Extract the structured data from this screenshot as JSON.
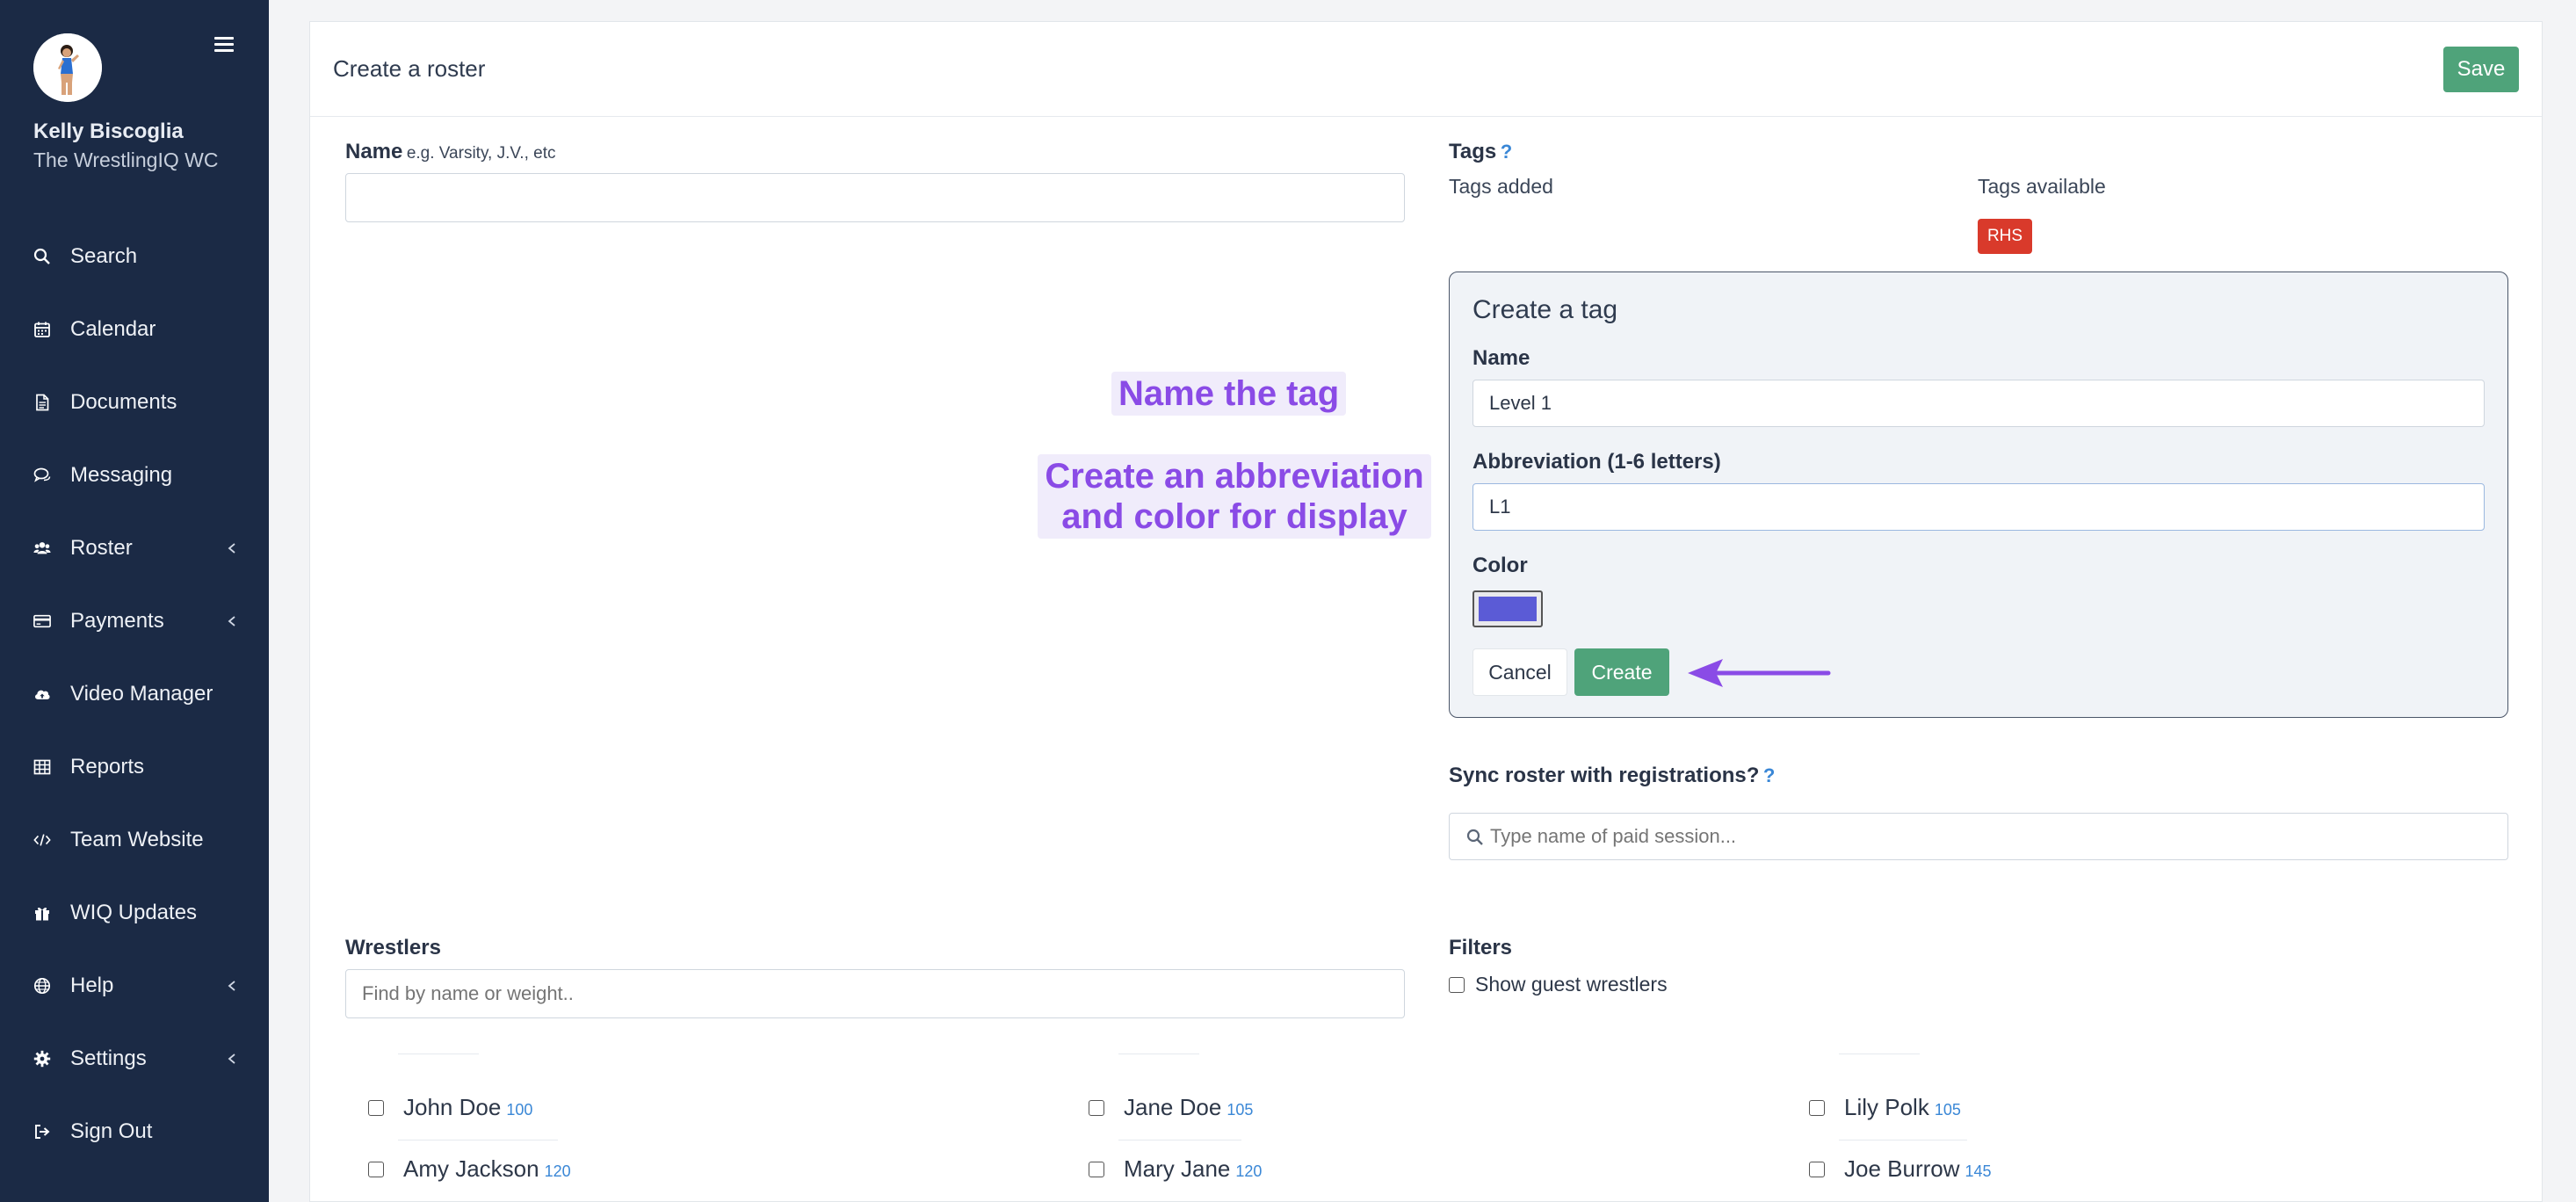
{
  "sidebar": {
    "user_name": "Kelly Biscoglia",
    "user_org": "The WrestlingIQ WC",
    "items": [
      {
        "label": "Search",
        "icon": "search-icon",
        "has_chevron": false
      },
      {
        "label": "Calendar",
        "icon": "calendar-icon",
        "has_chevron": false
      },
      {
        "label": "Documents",
        "icon": "document-icon",
        "has_chevron": false
      },
      {
        "label": "Messaging",
        "icon": "chat-icon",
        "has_chevron": false
      },
      {
        "label": "Roster",
        "icon": "users-icon",
        "has_chevron": true
      },
      {
        "label": "Payments",
        "icon": "credit-card-icon",
        "has_chevron": true
      },
      {
        "label": "Video Manager",
        "icon": "cloud-upload-icon",
        "has_chevron": false
      },
      {
        "label": "Reports",
        "icon": "table-icon",
        "has_chevron": false
      },
      {
        "label": "Team Website",
        "icon": "code-icon",
        "has_chevron": false
      },
      {
        "label": "WIQ Updates",
        "icon": "gift-icon",
        "has_chevron": false
      },
      {
        "label": "Help",
        "icon": "globe-icon",
        "has_chevron": true
      },
      {
        "label": "Settings",
        "icon": "gear-icon",
        "has_chevron": true
      },
      {
        "label": "Sign Out",
        "icon": "sign-out-icon",
        "has_chevron": false
      }
    ]
  },
  "header": {
    "title": "Create a roster",
    "save_label": "Save"
  },
  "name_field": {
    "label": "Name",
    "hint": "e.g. Varsity, J.V., etc",
    "value": ""
  },
  "tags": {
    "label": "Tags",
    "help": "?",
    "added_label": "Tags added",
    "available_label": "Tags available",
    "available": [
      {
        "label": "RHS",
        "color": "#d93a2b"
      }
    ]
  },
  "create_tag": {
    "title": "Create a tag",
    "name_label": "Name",
    "name_value": "Level 1",
    "abbr_label": "Abbreviation (1-6 letters)",
    "abbr_value": "L1",
    "color_label": "Color",
    "color_value": "#5b5bd6",
    "cancel_label": "Cancel",
    "create_label": "Create"
  },
  "callouts": {
    "name_tag": "Name the tag",
    "abbr_line1": "Create an abbreviation",
    "abbr_line2": "and color for display"
  },
  "sync": {
    "label": "Sync roster with registrations?",
    "help": "?",
    "placeholder": "Type name of paid session..."
  },
  "wrestlers": {
    "label": "Wrestlers",
    "placeholder": "Find by name or weight..",
    "list": [
      {
        "name": "John Doe",
        "weight": "100"
      },
      {
        "name": "Jane Doe",
        "weight": "105"
      },
      {
        "name": "Lily Polk",
        "weight": "105"
      },
      {
        "name": "Amy Jackson",
        "weight": "120"
      },
      {
        "name": "Mary Jane",
        "weight": "120"
      },
      {
        "name": "Joe Burrow",
        "weight": "145"
      }
    ]
  },
  "filters": {
    "label": "Filters",
    "guest_label": "Show guest wrestlers"
  },
  "colors": {
    "sidebar_bg": "#1b2a45",
    "save_green": "#4fa37a",
    "accent_blue": "#3a87d6",
    "callout_purple": "#8a4be6",
    "rhs_red": "#d93a2b"
  }
}
